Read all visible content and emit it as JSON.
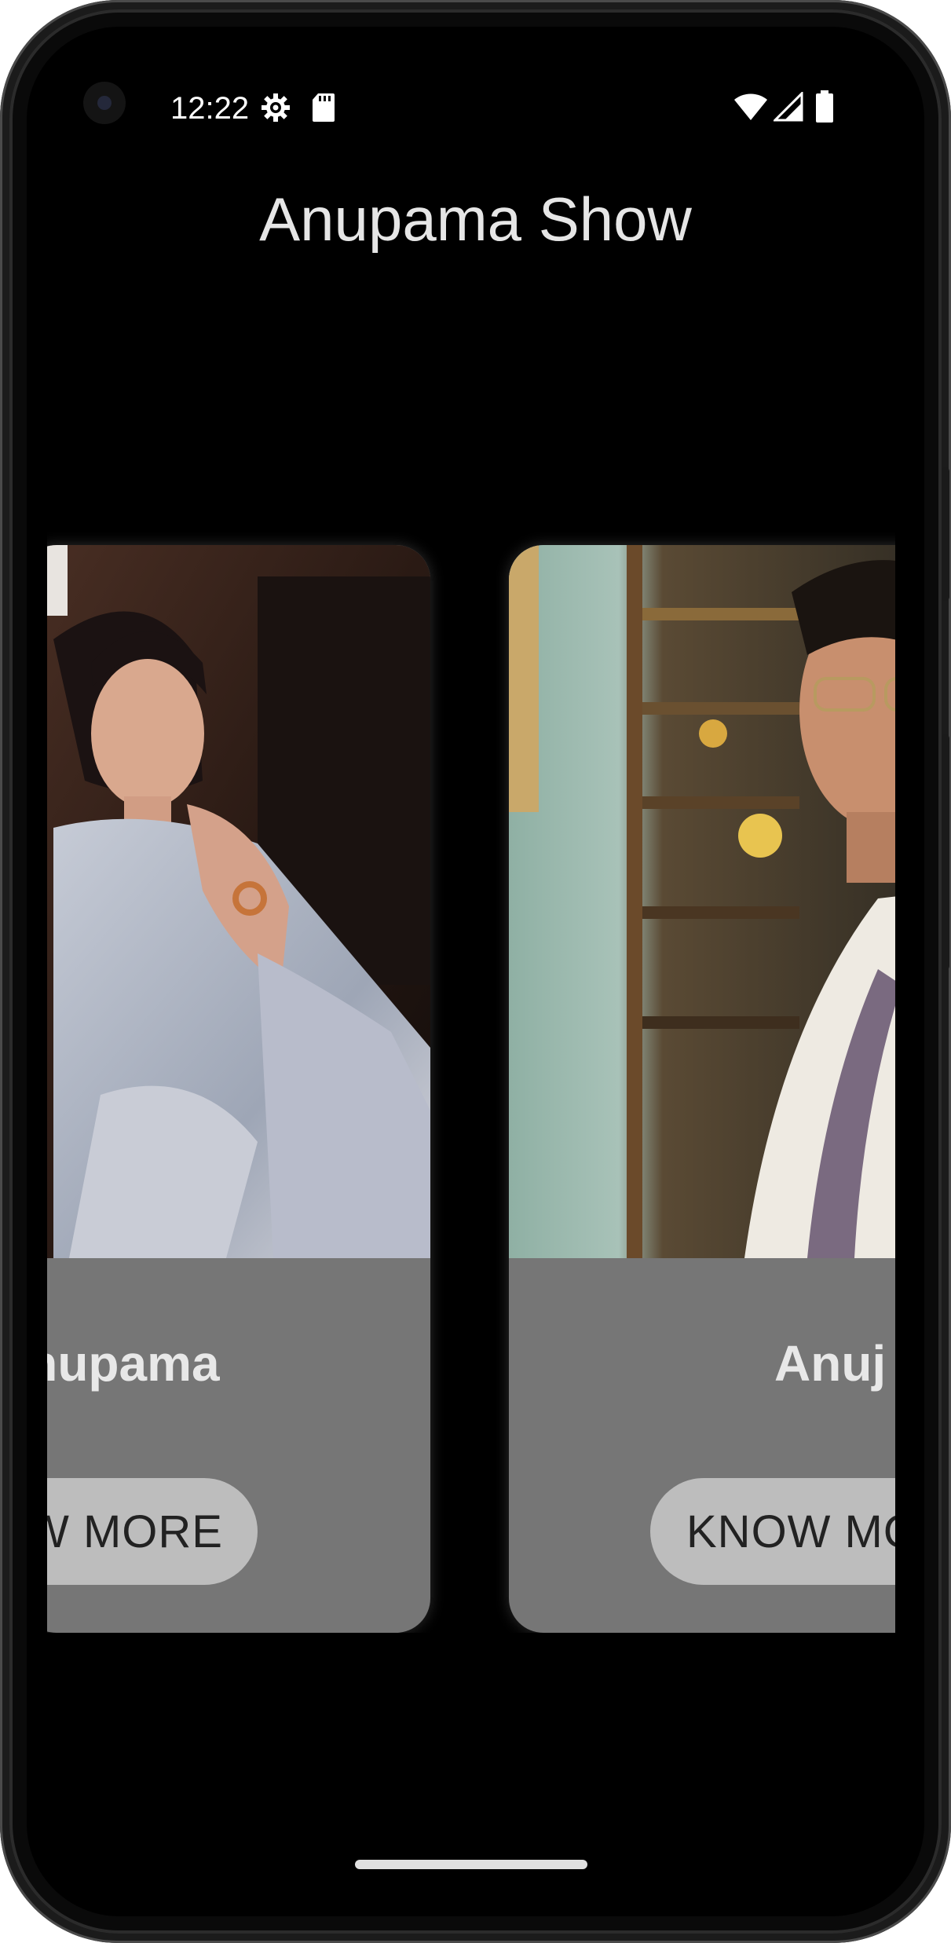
{
  "status_bar": {
    "time": "12:22",
    "left_icons": [
      "gear-icon",
      "sd-card-icon"
    ],
    "right_icons": [
      "wifi-icon",
      "signal-icon",
      "battery-icon"
    ]
  },
  "app": {
    "title": "Anupama Show"
  },
  "cards": [
    {
      "name": "Anupama",
      "button_label": "KNOW MORE"
    },
    {
      "name": "Anuj",
      "button_label": "KNOW MORE"
    }
  ],
  "colors": {
    "screen_background": "#000000",
    "card_background": "#767676",
    "button_background": "#bdbdbd",
    "title_text": "#e6e6e6"
  }
}
